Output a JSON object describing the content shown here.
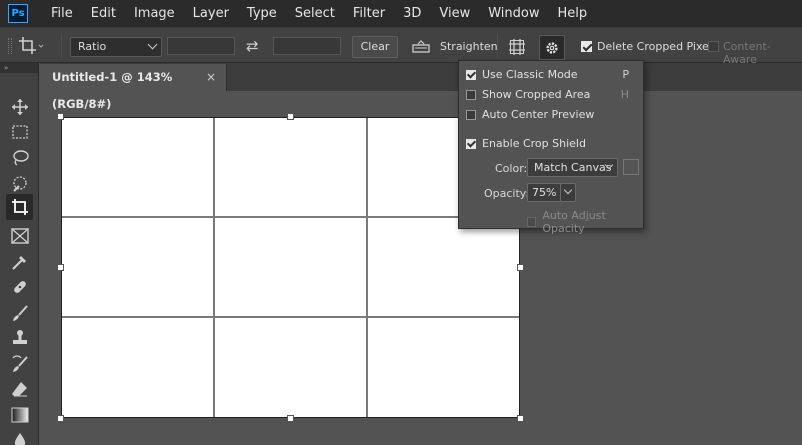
{
  "app": {
    "logo_text": "Ps"
  },
  "menu": [
    "File",
    "Edit",
    "Image",
    "Layer",
    "Type",
    "Select",
    "Filter",
    "3D",
    "View",
    "Window",
    "Help"
  ],
  "options": {
    "ratio_value": "Ratio",
    "clear_label": "Clear",
    "straighten_label": "Straighten",
    "delete_cropped_label": "Delete Cropped Pixels",
    "delete_cropped_checked": true,
    "content_aware_label": "Content-Aware",
    "content_aware_checked": false
  },
  "document": {
    "tab_title": "Untitled-1 @ 143% (RGB/8#)",
    "close_symbol": "×"
  },
  "tools_panel": {
    "collapse_glyph": "»"
  },
  "crop_settings": {
    "use_classic_mode": {
      "label": "Use Classic Mode",
      "shortcut": "P",
      "checked": true
    },
    "show_cropped_area": {
      "label": "Show Cropped Area",
      "shortcut": "H",
      "checked": false
    },
    "auto_center_preview": {
      "label": "Auto Center Preview",
      "checked": false
    },
    "enable_crop_shield": {
      "label": "Enable Crop Shield",
      "checked": true
    },
    "color_label": "Color:",
    "color_value": "Match Canvas",
    "opacity_label": "Opacity:",
    "opacity_value": "75%",
    "auto_adjust_opacity": {
      "label": "Auto Adjust Opacity",
      "checked": false,
      "disabled": true
    }
  },
  "colors": {
    "menubar_bg": "#2b2b2b",
    "toolbar_bg": "#424242",
    "workspace_bg": "#535353",
    "canvas_bg": "#ffffff",
    "accent": "#31a8ff"
  }
}
